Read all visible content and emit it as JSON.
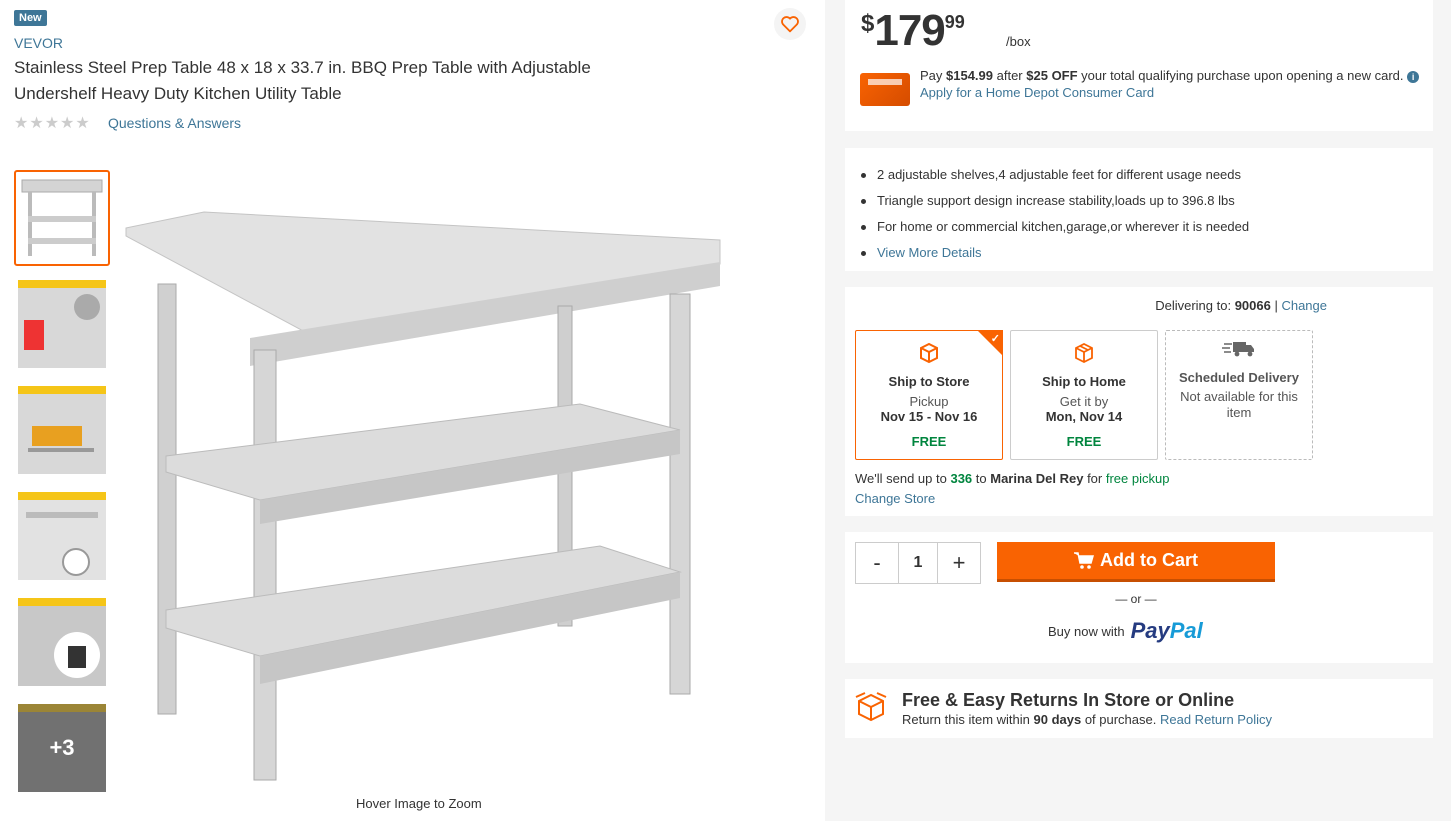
{
  "product": {
    "badge": "New",
    "brand": "VEVOR",
    "title": "Stainless Steel Prep Table 48 x 18 x 33.7 in. BBQ Prep Table with Adjustable Undershelf Heavy Duty Kitchen Utility Table",
    "stars": "★★★★★",
    "qa_link": "Questions & Answers",
    "more_thumbs": "+3",
    "hover_zoom": "Hover Image to Zoom"
  },
  "price": {
    "currency": "$",
    "whole": "179",
    "cents": "99",
    "unit": "/box"
  },
  "credit": {
    "pay": "Pay ",
    "amount": "$154.99",
    "after": " after ",
    "discount": "$25 OFF",
    "rest": " your total qualifying purchase upon opening a new card. ",
    "info": "i",
    "apply_link": "Apply for a Home Depot Consumer Card"
  },
  "highlights": [
    "2 adjustable shelves,4 adjustable feet for different usage needs",
    "Triangle support design increase stability,loads up to 396.8 lbs",
    "For home or commercial kitchen,garage,or wherever it is needed"
  ],
  "view_more": "View More Details",
  "delivery": {
    "label": "Delivering to: ",
    "zip": "90066",
    "sep": " | ",
    "change": "Change",
    "options": [
      {
        "name": "Ship to Store",
        "line1": "Pickup",
        "line2": "Nov 15 - Nov 16",
        "price": "FREE"
      },
      {
        "name": "Ship to Home",
        "line1": "Get it by",
        "line2": "Mon, Nov 14",
        "price": "FREE"
      },
      {
        "name": "Scheduled Delivery",
        "note": "Not available for this item"
      }
    ],
    "send_pre": "We'll send up to ",
    "send_qty": "336",
    "send_to": " to ",
    "send_store": "Marina Del Rey",
    "send_for": " for ",
    "send_free": "free pickup",
    "change_store": "Change Store"
  },
  "cart": {
    "minus": "-",
    "qty": "1",
    "plus": "+",
    "add_label": "Add to Cart",
    "or": "— or —",
    "buy_now": "Buy now with",
    "paypal_1": "Pay",
    "paypal_2": "Pal"
  },
  "returns": {
    "title": "Free & Easy Returns In Store or Online",
    "sub_pre": "Return this item within ",
    "days": "90 days",
    "sub_post": " of purchase. ",
    "link": "Read Return Policy"
  },
  "colors": {
    "accent": "#f96302",
    "link": "#3e7697",
    "green": "#00853e"
  }
}
